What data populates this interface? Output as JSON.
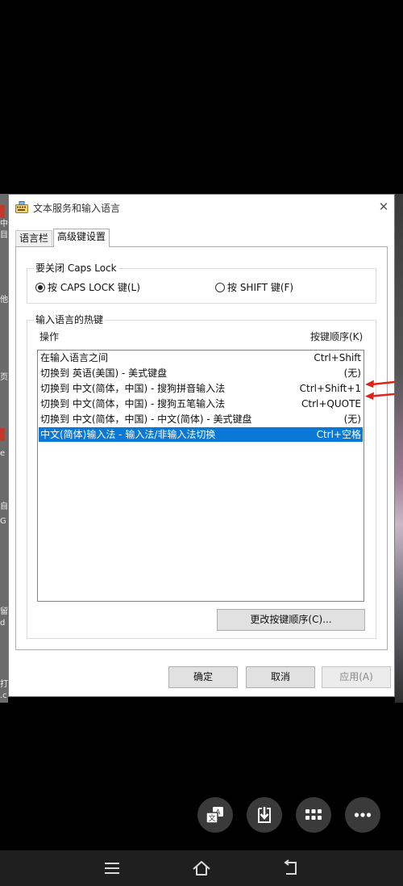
{
  "window": {
    "title": "文本服务和输入语言",
    "close_symbol": "✕"
  },
  "tabs": [
    {
      "label": "语言栏",
      "active": false
    },
    {
      "label": "高级键设置",
      "active": true
    }
  ],
  "caps_lock": {
    "group_label": "要关闭 Caps Lock",
    "option_caps": "按 CAPS LOCK 键(L)",
    "option_shift": "按 SHIFT 键(F)",
    "selected": "caps"
  },
  "hotkeys": {
    "group_label": "输入语言的热键",
    "col_action": "操作",
    "col_keys": "按键顺序(K)",
    "rows": [
      {
        "action": "在输入语言之间",
        "keys": "Ctrl+Shift",
        "selected": false
      },
      {
        "action": "切换到 英语(美国) - 美式键盘",
        "keys": "(无)",
        "selected": false
      },
      {
        "action": "切换到 中文(简体，中国) - 搜狗拼音输入法",
        "keys": "Ctrl+Shift+1",
        "selected": false
      },
      {
        "action": "切换到 中文(简体，中国) - 搜狗五笔输入法",
        "keys": "Ctrl+QUOTE",
        "selected": false
      },
      {
        "action": "切换到 中文(简体，中国) - 中文(简体) - 美式键盘",
        "keys": "(无)",
        "selected": false
      },
      {
        "action": "中文(简体)输入法 - 输入法/非输入法切换",
        "keys": "Ctrl+空格",
        "selected": true
      }
    ],
    "change_button": "更改按键顺序(C)..."
  },
  "footer": {
    "ok": "确定",
    "cancel": "取消",
    "apply": "应用(A)"
  },
  "desktop_edge": [
    "中",
    "目",
    "他",
    "页",
    "e",
    "自",
    "G",
    "留",
    "d",
    "打",
    ".c"
  ],
  "floating_buttons": [
    "translate-icon",
    "download-icon",
    "grid-icon",
    "more-icon"
  ],
  "colors": {
    "selection": "#0a78d7",
    "annotation_arrow": "#e0241b"
  }
}
